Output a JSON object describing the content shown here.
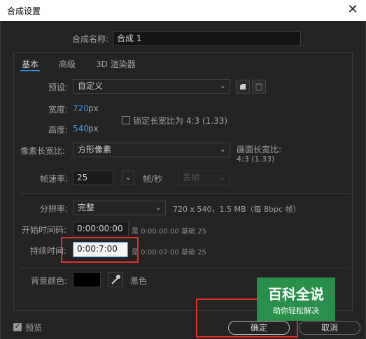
{
  "window": {
    "title": "合成设置",
    "close_glyph": "✕"
  },
  "comp_name": {
    "label": "合成名称:",
    "value": "合成 1"
  },
  "tabs": [
    {
      "label": "基本"
    },
    {
      "label": "高级"
    },
    {
      "label": "3D 渲染器"
    }
  ],
  "preset": {
    "label": "预设:",
    "value": "自定义"
  },
  "width": {
    "label": "宽度:",
    "value": "720",
    "unit": "px"
  },
  "height": {
    "label": "高度:",
    "value": "540",
    "unit": "px"
  },
  "lock_aspect": {
    "label": "锁定长宽比为 4:3 (1.33)",
    "checked": false
  },
  "pixel_aspect": {
    "label": "像素长宽比:",
    "value": "方形像素"
  },
  "frame_aspect": {
    "label": "画面长宽比:",
    "value": "4:3 (1.33)"
  },
  "frame_rate": {
    "label": "帧速率:",
    "value": "25",
    "unit": "帧/秒",
    "drop_value": "丢帧"
  },
  "resolution": {
    "label": "分辨率:",
    "value": "完整",
    "info": "720 x 540，1.5 MB（每 8bpc 帧）"
  },
  "start_timecode": {
    "label": "开始时间码:",
    "value": "0:00:00:00",
    "note": "是 0:00:00:00  基础 25"
  },
  "duration": {
    "label": "持续时间:",
    "value": "0:00:7:00",
    "note": "是 0:00:07:00  基础 25"
  },
  "background": {
    "label": "背景颜色:",
    "color": "#000000",
    "color_name": "黑色"
  },
  "preview": {
    "label": "预览",
    "checked": true
  },
  "buttons": {
    "ok": "确定",
    "cancel": "取消"
  },
  "watermark": {
    "title": "百科全说",
    "subtitle": "助你轻松解决"
  },
  "colors": {
    "accent": "#2f8fe0",
    "highlight": "#e0302c",
    "value_blue": "#3d94dd"
  },
  "icons": {
    "save_preset": "save-preset-icon",
    "delete_preset": "trash-icon",
    "eyedropper": "eyedropper-icon"
  }
}
